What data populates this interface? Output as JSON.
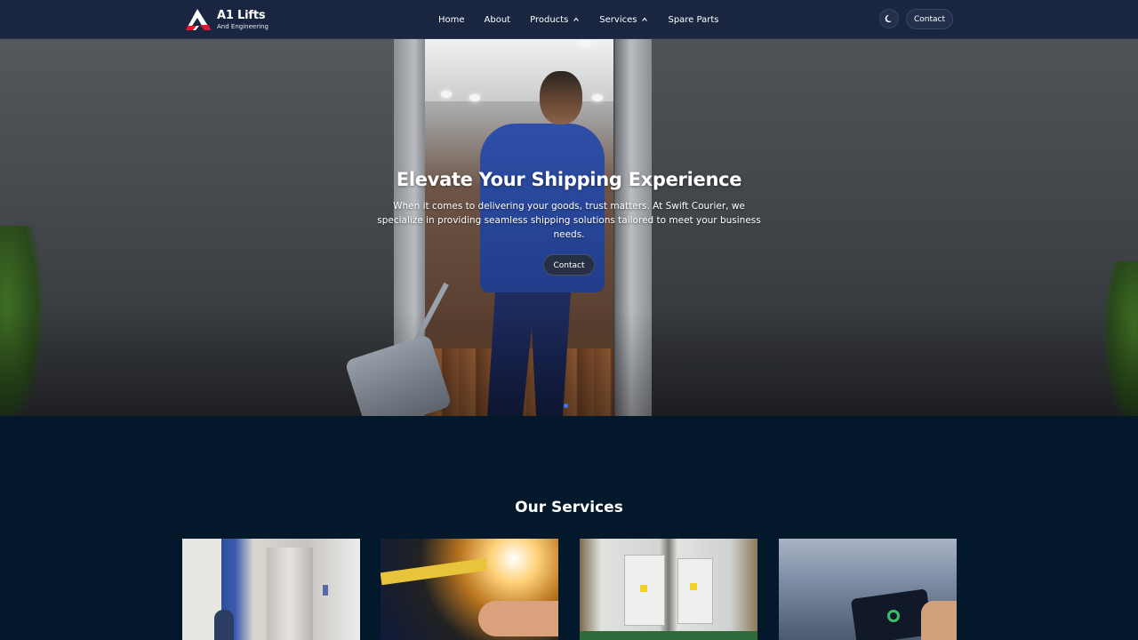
{
  "nav": {
    "logo_title": "A1 Lifts",
    "logo_subtitle": "And Engineering",
    "links": [
      {
        "label": "Home"
      },
      {
        "label": "About"
      },
      {
        "label": "Products"
      },
      {
        "label": "Services"
      },
      {
        "label": "Spare Parts"
      }
    ],
    "contact_label": "Contact",
    "theme_icon": "moon-icon"
  },
  "hero": {
    "title": "Elevate Your Shipping Experience",
    "text": "When it comes to delivering your goods, trust matters. At Swift Courier, we specialize in providing seamless shipping solutions tailored to meet your business needs.",
    "button_label": "Contact",
    "active_slide_color": "#2d7ff9"
  },
  "services": {
    "title": "Our Services",
    "cards": [
      {
        "image": "elevator-installation-photo"
      },
      {
        "image": "elevator-machinery-repair-photo"
      },
      {
        "image": "electrical-control-panels-photo"
      },
      {
        "image": "tablet-monitoring-photo"
      }
    ]
  },
  "colors": {
    "navbar_bg": "#1a2540",
    "page_bg": "#03182b",
    "brand_red": "#e0182d"
  }
}
